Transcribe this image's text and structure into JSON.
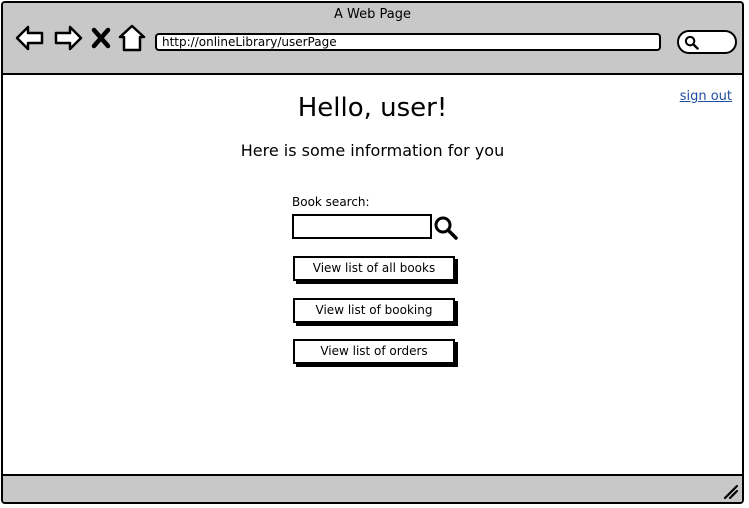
{
  "window": {
    "title": "A Web Page"
  },
  "browser": {
    "url": "http://onlineLibrary/userPage"
  },
  "header": {
    "sign_out_label": "sign out"
  },
  "main": {
    "greeting": "Hello, user!",
    "subtitle": "Here is some information for you",
    "search": {
      "label": "Book search:",
      "value": "",
      "placeholder": ""
    },
    "buttons": {
      "all_books": "View list of all books",
      "booking": "View list of booking",
      "orders": "View list of orders"
    }
  },
  "icons": {
    "back": "back-arrow-icon",
    "forward": "forward-arrow-icon",
    "close": "close-icon",
    "home": "home-icon",
    "search": "search-icon",
    "resize": "resize-grip-icon"
  },
  "colors": {
    "chrome": "#c8c8c8",
    "link": "#1f4e9e",
    "border": "#000000"
  }
}
